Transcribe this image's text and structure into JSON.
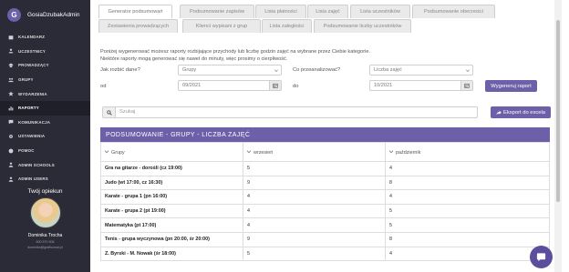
{
  "sidebar": {
    "logo_letter": "G",
    "user": "GosiaDzubakAdmin",
    "items": [
      {
        "label": "KALENDARZ",
        "icon": "calendar-icon"
      },
      {
        "label": "UCZESTNICY",
        "icon": "users-icon"
      },
      {
        "label": "PROWADZĄCY",
        "icon": "teacher-icon"
      },
      {
        "label": "GRUPY",
        "icon": "group-icon"
      },
      {
        "label": "WYDARZENIA",
        "icon": "event-icon"
      },
      {
        "label": "RAPORTY",
        "icon": "chart-icon",
        "active": true
      },
      {
        "label": "KOMUNIKACJA",
        "icon": "chat-icon"
      },
      {
        "label": "USTAWIENIA",
        "icon": "gear-icon"
      },
      {
        "label": "POMOC",
        "icon": "help-icon"
      },
      {
        "label": "ADMIN SCHOOLS",
        "icon": "user-icon"
      },
      {
        "label": "ADMIN USERS",
        "icon": "user-icon"
      }
    ],
    "opiekun": {
      "title": "Twój opiekun",
      "name": "Dominika Trocha",
      "phone": "600 570 306",
      "email": "dominika@grafikomat.pl"
    }
  },
  "tabs": [
    {
      "label": "Generator podsumowań",
      "active": true
    },
    {
      "label": "Podsumowanie zapisów"
    },
    {
      "label": "Lista płatności"
    },
    {
      "label": "Lista zajęć"
    },
    {
      "label": "Lista uczestników"
    },
    {
      "label": "Podsumowanie obecności"
    },
    {
      "label": "Zestawienia prowadzących"
    },
    {
      "label": "Klienci wypisani z grup"
    },
    {
      "label": "Lista zaległości"
    },
    {
      "label": "Podsumowanie liczby uczestników"
    }
  ],
  "description": {
    "line1": "Poniżej wygenerować możesz raporty rozbijające przychody lub liczbę godzin zajęć na wybrane przez Ciebie kategorie.",
    "line2": "Niektóre raporty mogą generować się nawet do minuty, więc prosimy o cierpliwość."
  },
  "form": {
    "split_label": "Jak rozbić dane?",
    "split_value": "Grupy",
    "analyze_label": "Co przeanalizować?",
    "analyze_value": "Liczba zajęć",
    "from_label": "od",
    "from_value": "09/2021",
    "to_label": "do",
    "to_value": "10/2021",
    "generate_label": "Wygeneruj raport"
  },
  "search": {
    "placeholder": "Szukaj"
  },
  "export_label": "Eksport do excela",
  "table": {
    "title": "PODSUMOWANIE - GRUPY - LICZBA ZAJĘĆ",
    "columns": [
      "Grupy",
      "wrzesień",
      "październik"
    ],
    "rows": [
      [
        "Gra na gitarze - dorośli (cz 19:00)",
        "5",
        "4"
      ],
      [
        "Judo (wt 17:00, cz 16:30)",
        "9",
        "8"
      ],
      [
        "Karate - grupa 1 (pn 16:00)",
        "4",
        "4"
      ],
      [
        "Karate - grupa 2 (pt 19:00)",
        "4",
        "5"
      ],
      [
        "Matematyka (pt 17:00)",
        "4",
        "5"
      ],
      [
        "Tenis - grupa wyczynowa (pn 20:00, śr 20:00)",
        "9",
        "8"
      ],
      [
        "Z. Byrski - M. Nowak (śr 18:00)",
        "5",
        "4"
      ]
    ]
  }
}
